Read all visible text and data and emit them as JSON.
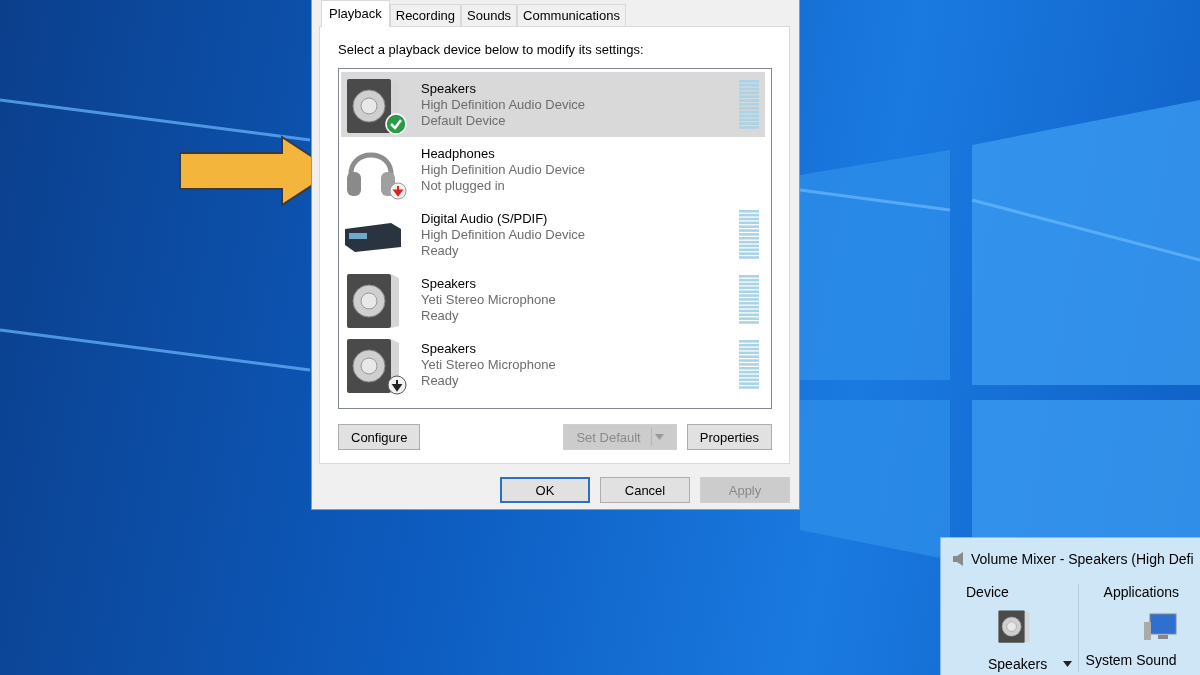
{
  "dialog": {
    "tabs": [
      {
        "label": "Playback",
        "selected": true
      },
      {
        "label": "Recording",
        "selected": false
      },
      {
        "label": "Sounds",
        "selected": false
      },
      {
        "label": "Communications",
        "selected": false
      }
    ],
    "instruction": "Select a playback device below to modify its settings:",
    "devices": [
      {
        "name": "Speakers",
        "description": "High Definition Audio Device",
        "status": "Default Device",
        "kind": "speaker",
        "default_device": true,
        "unplugged": false,
        "arrow_badge": false,
        "meter": true,
        "selected": true
      },
      {
        "name": "Headphones",
        "description": "High Definition Audio Device",
        "status": "Not plugged in",
        "kind": "headphones",
        "default_device": false,
        "unplugged": true,
        "arrow_badge": false,
        "meter": false,
        "selected": false
      },
      {
        "name": "Digital Audio (S/PDIF)",
        "description": "High Definition Audio Device",
        "status": "Ready",
        "kind": "digital",
        "default_device": false,
        "unplugged": false,
        "arrow_badge": false,
        "meter": true,
        "selected": false
      },
      {
        "name": "Speakers",
        "description": "Yeti Stereo Microphone",
        "status": "Ready",
        "kind": "speaker",
        "default_device": false,
        "unplugged": false,
        "arrow_badge": false,
        "meter": true,
        "selected": false
      },
      {
        "name": "Speakers",
        "description": "Yeti Stereo Microphone",
        "status": "Ready",
        "kind": "speaker",
        "default_device": false,
        "unplugged": false,
        "arrow_badge": true,
        "meter": true,
        "selected": false
      }
    ],
    "buttons": [
      {
        "label": "Configure",
        "disabled": false,
        "kind": "plain"
      },
      {
        "label": "Set Default",
        "disabled": true,
        "kind": "split"
      },
      {
        "label": "Properties",
        "disabled": false,
        "kind": "plain"
      }
    ],
    "footer_buttons": [
      {
        "label": "OK",
        "disabled": false,
        "focused": true
      },
      {
        "label": "Cancel",
        "disabled": false,
        "focused": false
      },
      {
        "label": "Apply",
        "disabled": true,
        "focused": false
      }
    ]
  },
  "mixer": {
    "title": "Volume Mixer - Speakers (High Defi",
    "device_heading": "Device",
    "applications_heading": "Applications",
    "device": "Speakers",
    "application": "System Sound"
  }
}
